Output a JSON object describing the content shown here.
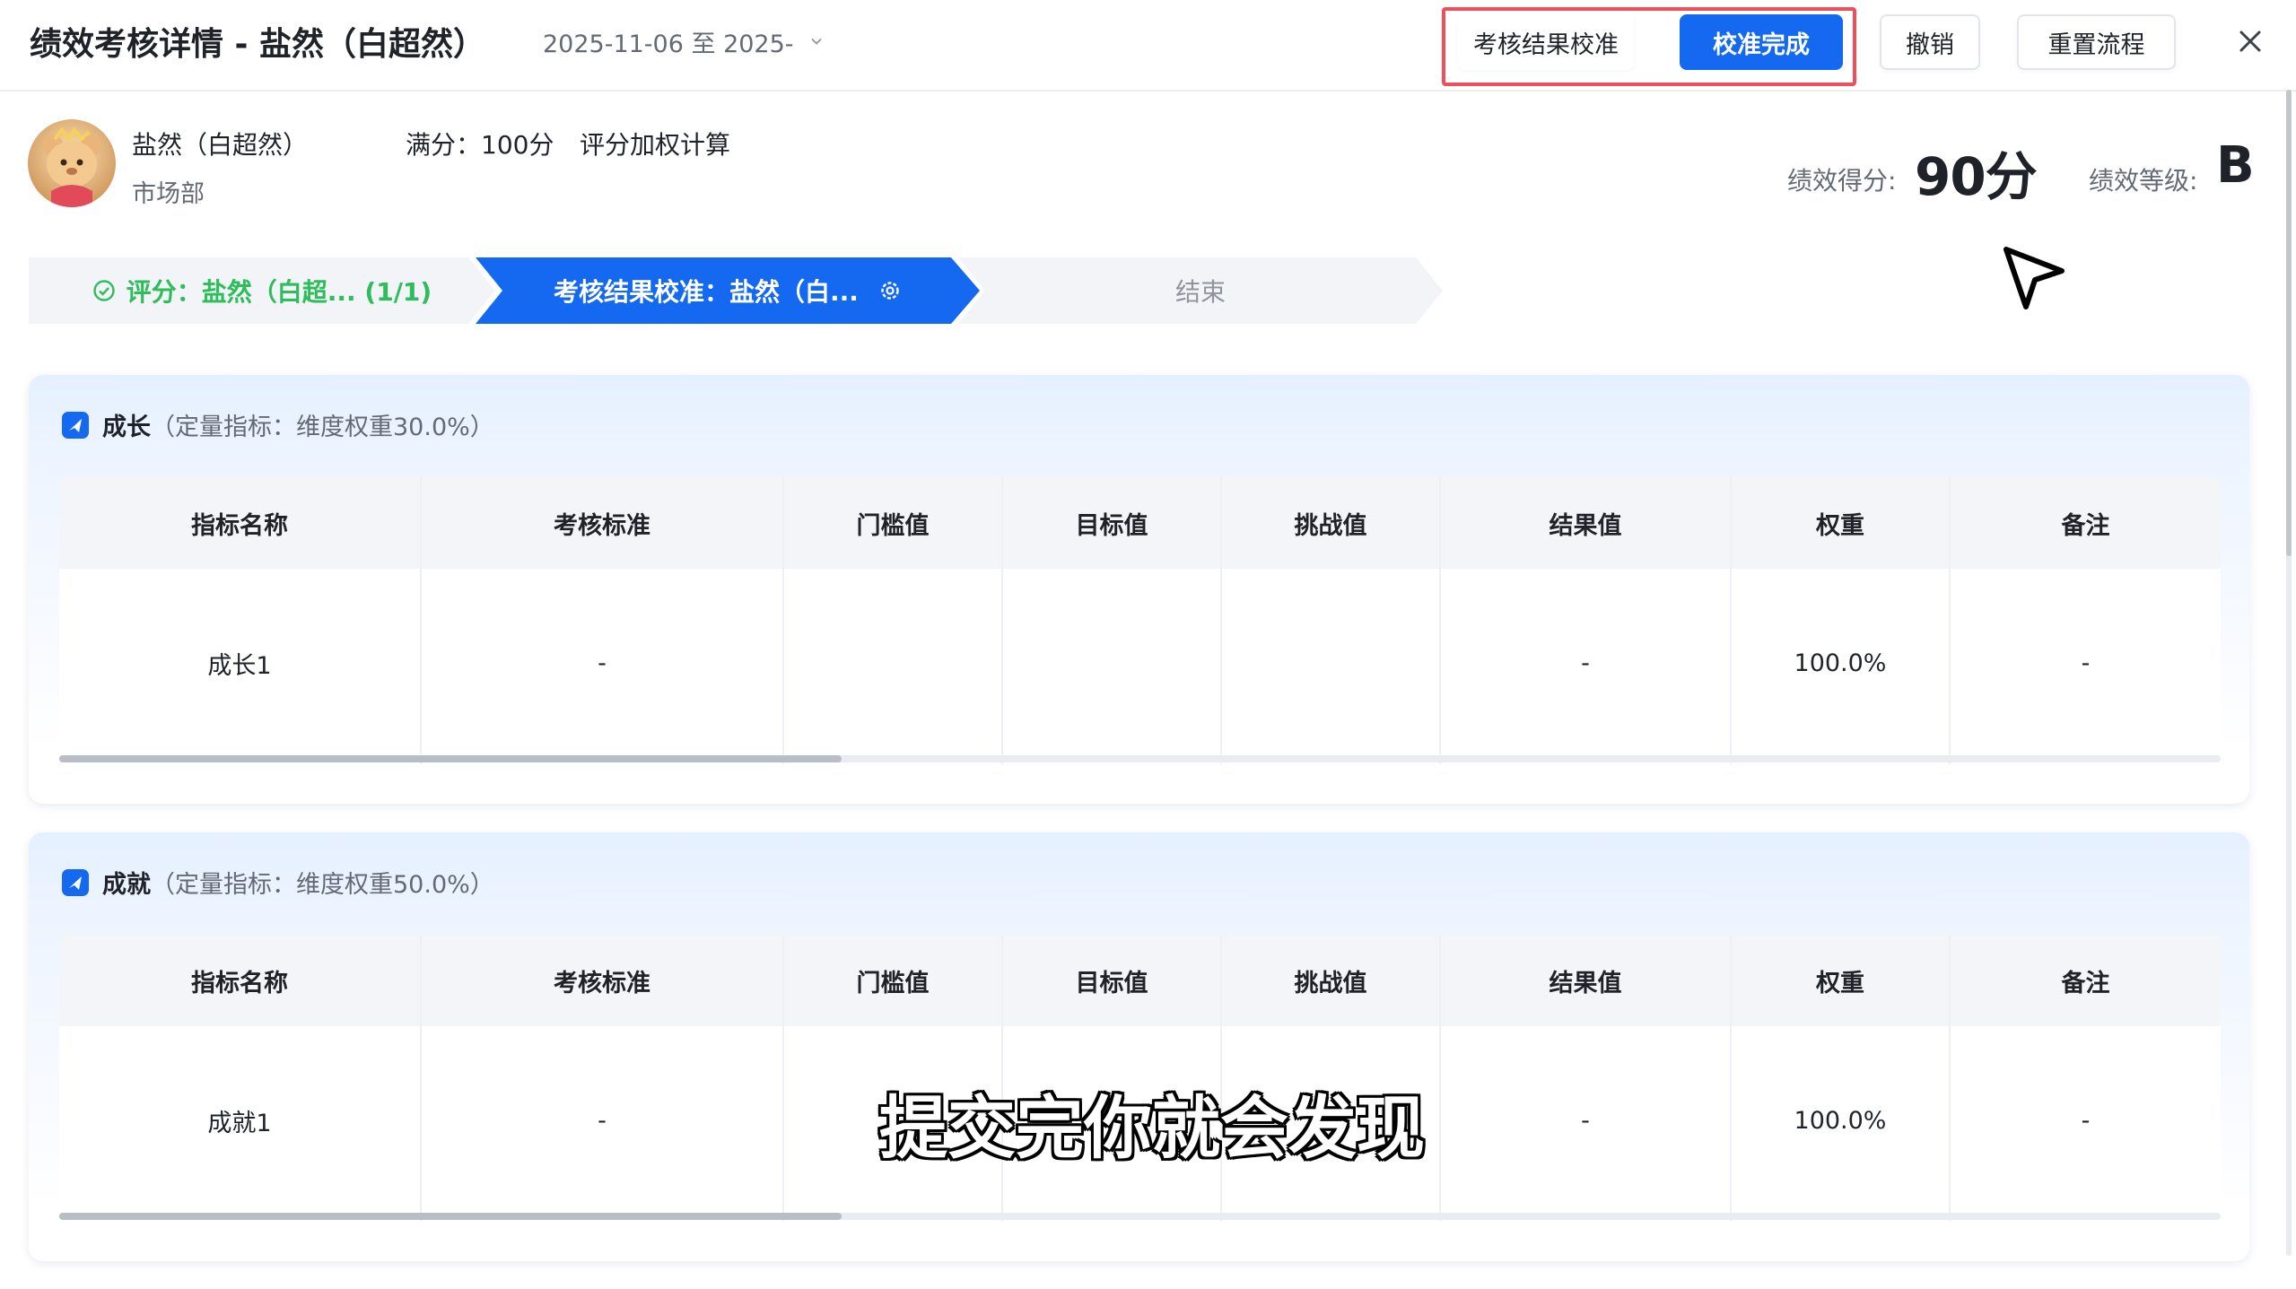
{
  "header": {
    "title": "绩效考核详情 - 盐然（白超然）",
    "date_range": "2025-11-06 至 2025-",
    "buttons": {
      "calibrate": "考核结果校准",
      "done": "校准完成",
      "undo": "撤销",
      "reset": "重置流程"
    }
  },
  "profile": {
    "name": "盐然（白超然）",
    "department": "市场部",
    "full_score": "满分：100分",
    "calc_method": "评分加权计算",
    "score_label": "绩效得分:",
    "score_value": "90分",
    "grade_label": "绩效等级:",
    "grade_value": "B"
  },
  "steps": [
    {
      "label": "评分：盐然（白超... (1/1)",
      "status": "done"
    },
    {
      "label": "考核结果校准：盐然（白...",
      "status": "active"
    },
    {
      "label": "结束",
      "status": "pending"
    }
  ],
  "table_columns": [
    "指标名称",
    "考核标准",
    "门槛值",
    "目标值",
    "挑战值",
    "结果值",
    "权重",
    "备注"
  ],
  "sections": [
    {
      "title": "成长",
      "desc": "（定量指标：维度权重30.0%）",
      "rows": [
        [
          "成长1",
          "-",
          "",
          "",
          "",
          "-",
          "100.0%",
          "-"
        ]
      ]
    },
    {
      "title": "成就",
      "desc": "（定量指标：维度权重50.0%）",
      "rows": [
        [
          "成就1",
          "-",
          "",
          "",
          "",
          "-",
          "100.0%",
          "-"
        ]
      ]
    }
  ],
  "subtitle": "提交完你就会发现",
  "colors": {
    "primary": "#1469f0",
    "success": "#2dbd5b",
    "highlight": "#ef4f5a"
  }
}
